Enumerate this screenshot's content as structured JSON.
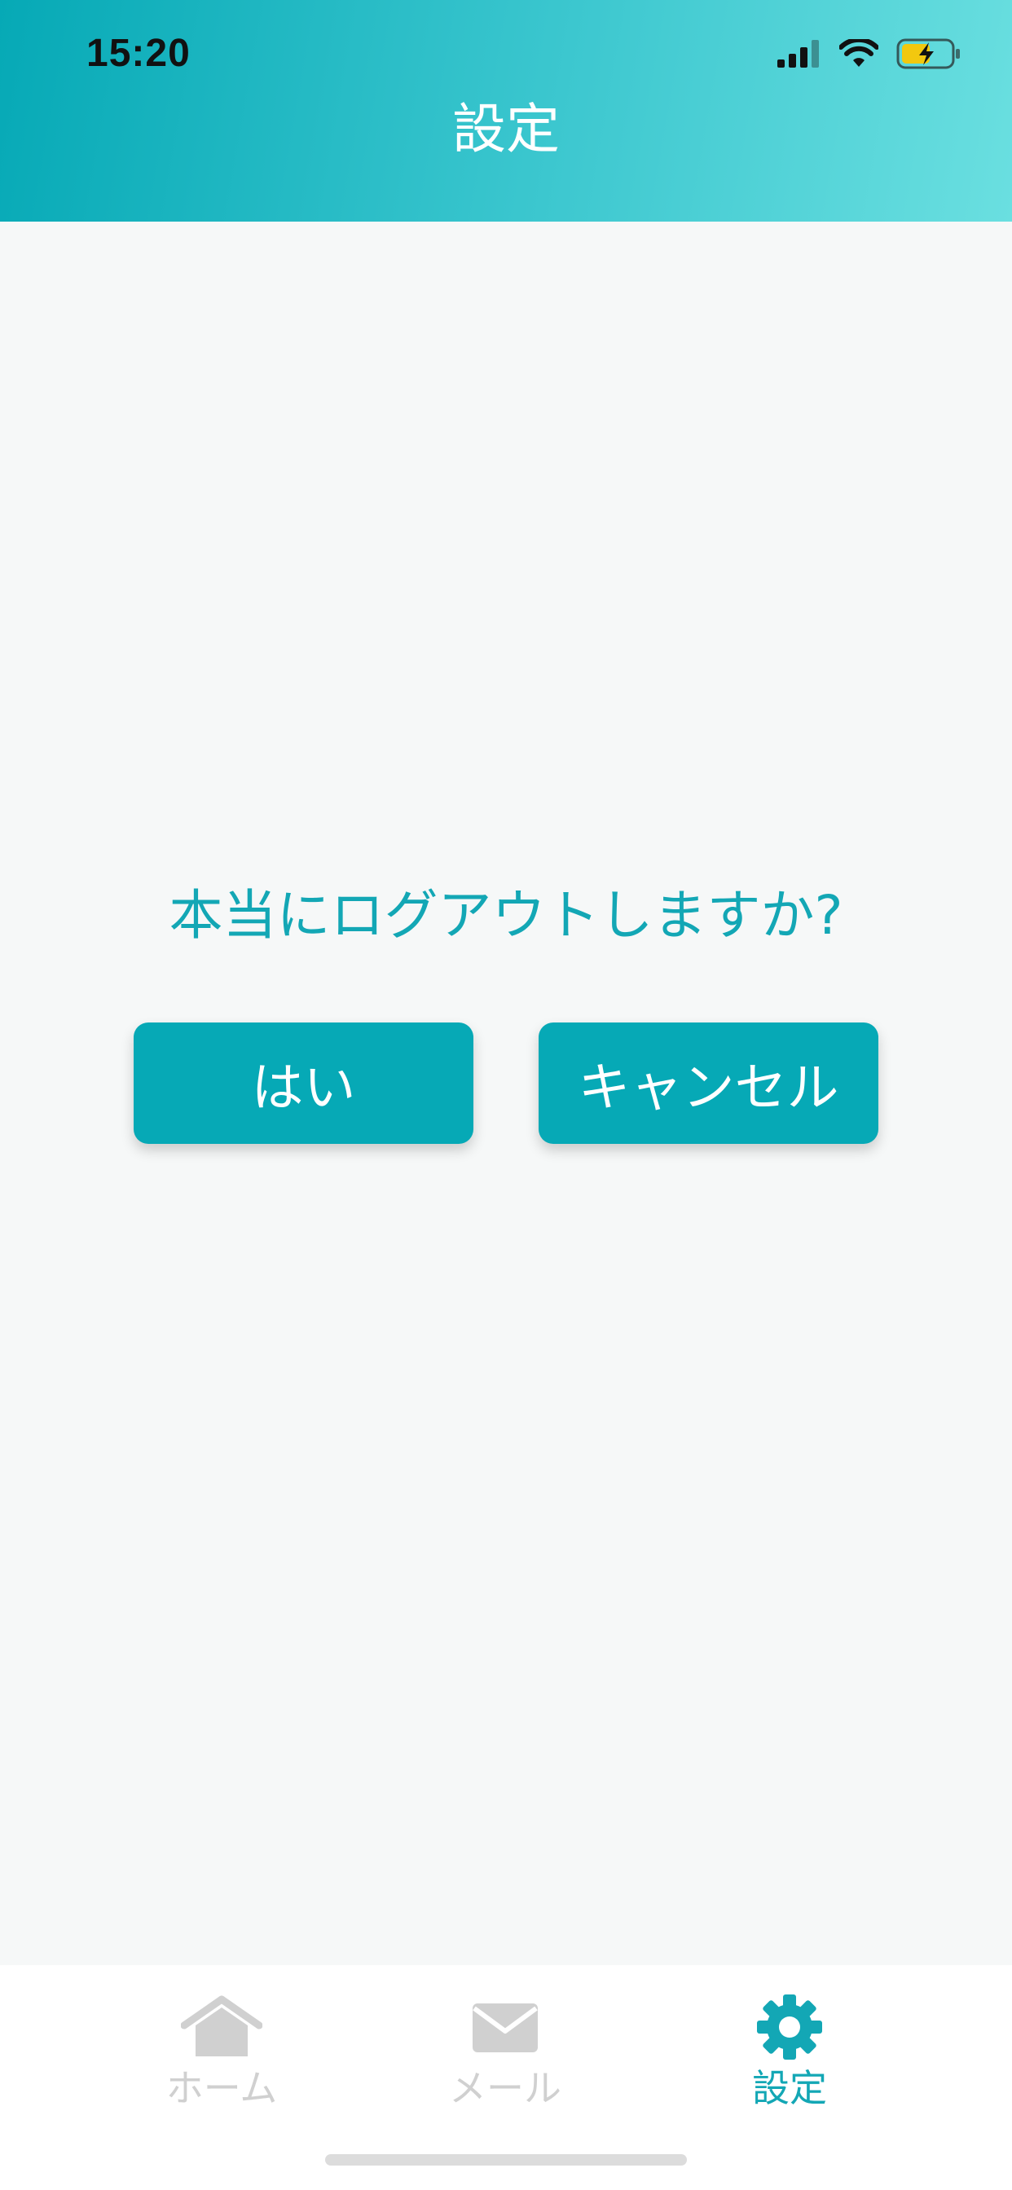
{
  "status_bar": {
    "time": "15:20"
  },
  "header": {
    "title": "設定"
  },
  "dialog": {
    "question": "本当にログアウトしますか?",
    "yes_label": "はい",
    "cancel_label": "キャンセル"
  },
  "tabbar": {
    "items": [
      {
        "label": "ホーム",
        "icon": "home-icon",
        "active": false
      },
      {
        "label": "メール",
        "icon": "mail-icon",
        "active": false
      },
      {
        "label": "設定",
        "icon": "gear-icon",
        "active": true
      }
    ]
  },
  "colors": {
    "accent": "#06a9b6",
    "accent_text": "#13a7b5",
    "inactive_tab": "#d0d0d0",
    "background": "#f6f8f8"
  }
}
